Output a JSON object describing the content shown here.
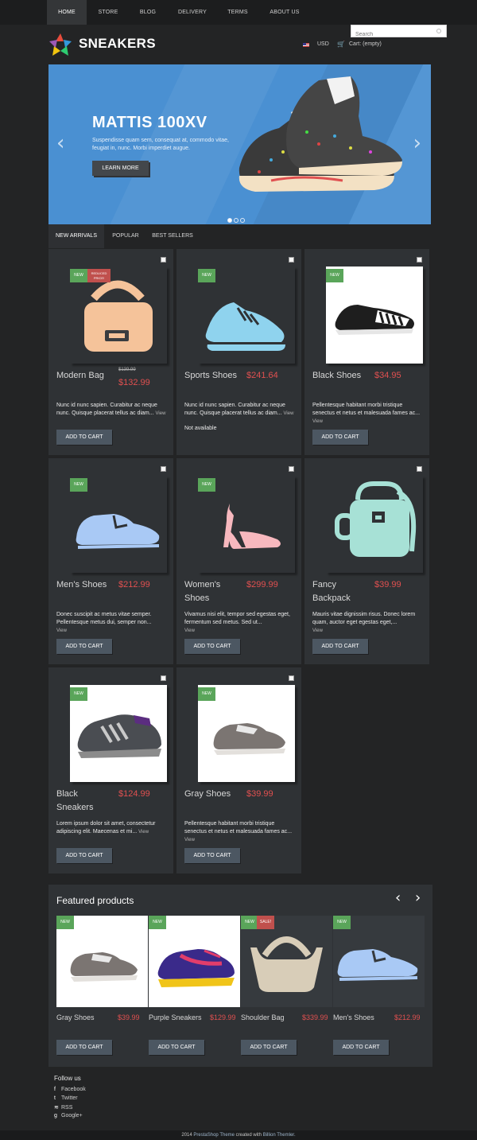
{
  "nav": [
    "HOME",
    "STORE",
    "BLOG",
    "DELIVERY",
    "TERMS",
    "ABOUT US"
  ],
  "brand": "SNEAKERS",
  "search": {
    "placeholder": "Search"
  },
  "currency": "USD",
  "cart": "Cart: (empty)",
  "slider": {
    "title": "MATTIS 100XV",
    "text": "Suspendisse quam sem, consequat at, commodo vitae, feugiat in, nunc. Morbi imperdiet augue.",
    "button": "LEARN MORE",
    "prev": "‹",
    "next": "›"
  },
  "tabs": [
    "NEW ARRIVALS",
    "POPULAR",
    "BEST SELLERS"
  ],
  "badges": {
    "new": "NEW",
    "reduced": "REDUCED PRICE!",
    "sale": "SALE!"
  },
  "products": [
    {
      "name": "Modern Bag",
      "old_price": "$139.99",
      "price": "$132.99",
      "desc": "Nunc id nunc sapien. Curabitur ac neque nunc. Quisque placerat tellus ac diam...",
      "view": "View",
      "add": "ADD TO CART"
    },
    {
      "name": "Sports Shoes",
      "price": "$241.64",
      "desc": "Nunc id nunc sapien. Curabitur ac neque nunc. Quisque placerat tellus ac diam...",
      "view": "View",
      "availability": "Not available",
      "add": "ADD TO CART"
    },
    {
      "name": "Black Shoes",
      "price": "$34.95",
      "desc": "Pellentesque habitant morbi tristique senectus et netus et malesuada fames ac...",
      "view": "View",
      "add": "ADD TO CART"
    },
    {
      "name": "Men's Shoes",
      "price": "$212.99",
      "desc": "Donec suscipit ac metus vitae semper. Pellentesque metus dui, semper non...",
      "view": "View",
      "add": "ADD TO CART"
    },
    {
      "name": "Women's Shoes",
      "price": "$299.99",
      "desc": "Vivamus nisi elit, tempor sed egestas eget, fermentum sed metus. Sed ut...",
      "view": "View",
      "add": "ADD TO CART"
    },
    {
      "name": "Fancy Backpack",
      "price": "$39.99",
      "desc": "Mauris vitae dignissim risus. Donec lorem quam, auctor eget egestas eget,...",
      "view": "View",
      "add": "ADD TO CART"
    },
    {
      "name": "Black Sneakers",
      "price": "$124.99",
      "desc": "Lorem ipsum dolor sit amet, consectetur adipiscing elit. Maecenas et mi...",
      "view": "View",
      "add": "ADD TO CART"
    },
    {
      "name": "Gray Shoes",
      "price": "$39.99",
      "desc": "Pellentesque habitant morbi tristique senectus et netus et malesuada fames ac...",
      "view": "View",
      "add": "ADD TO CART"
    }
  ],
  "featured": {
    "title": "Featured products",
    "prev": "‹",
    "next": "›",
    "items": [
      {
        "name": "Gray Shoes",
        "price": "$39.99",
        "add": "ADD TO CART"
      },
      {
        "name": "Purple Sneakers",
        "price": "$129.99",
        "add": "ADD TO CART"
      },
      {
        "name": "Shoulder Bag",
        "price": "$339.99",
        "add": "ADD TO CART"
      },
      {
        "name": "Men's Shoes",
        "price": "$212.99",
        "add": "ADD TO CART"
      }
    ]
  },
  "follow": {
    "title": "Follow us",
    "links": [
      "Facebook",
      "Twitter",
      "RSS",
      "Google+"
    ]
  },
  "footer": {
    "year": "2014",
    "theme": "PrestaShop Theme",
    "created": "created with",
    "author": "Billion Themler."
  },
  "colors": {
    "accent": "#e05050",
    "slider_bg": "#4a90d2",
    "badge_new": "#5aa55a",
    "badge_sale": "#c0504d"
  }
}
